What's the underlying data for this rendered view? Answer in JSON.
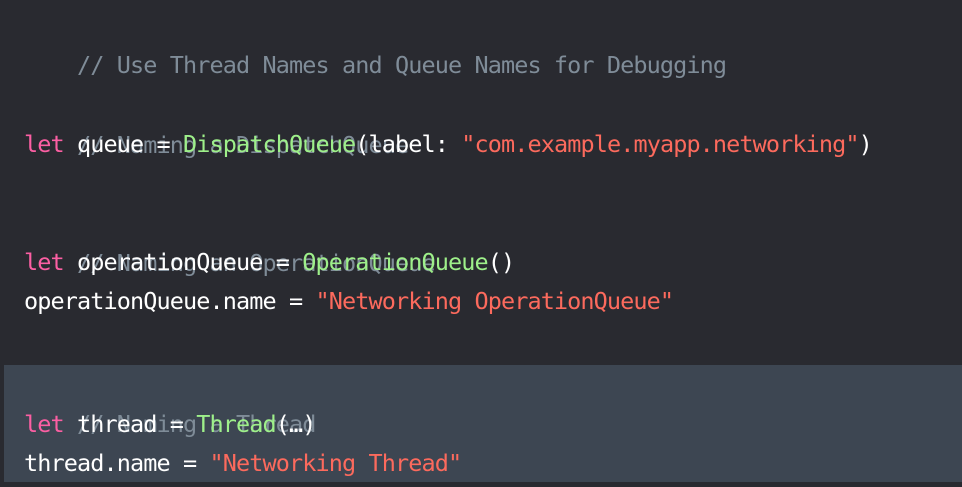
{
  "colors": {
    "background": "#292a30",
    "highlight": "#3d4652",
    "comment": "#7f8c98",
    "keyword": "#fc5fa3",
    "type": "#9ef08a",
    "string": "#fc6a5d",
    "plain": "#ffffff"
  },
  "code": {
    "line1": {
      "comment": "// Use Thread Names and Queue Names for Debugging"
    },
    "line2": {
      "comment": "// Naming a DispatchQueue"
    },
    "line3": {
      "keyword": "let",
      "text1": " queue = ",
      "type": "DispatchQueue",
      "text2": "(label: ",
      "string": "\"com.example.myapp.networking\"",
      "text3": ")"
    },
    "line4": {
      "comment": "// Naming an OperationQueue"
    },
    "line5": {
      "keyword": "let",
      "text1": " operationQueue = ",
      "type": "OperationQueue",
      "text2": "()"
    },
    "line6": {
      "text1": "operationQueue.name = ",
      "string": "\"Networking OperationQueue\""
    },
    "line7": {
      "comment": "// Naming a Thread"
    },
    "line8": {
      "keyword": "let",
      "text1": " thread = ",
      "type": "Thread",
      "text2": "(…)"
    },
    "line9": {
      "text1": "thread.name = ",
      "string": "\"Networking Thread\""
    }
  }
}
